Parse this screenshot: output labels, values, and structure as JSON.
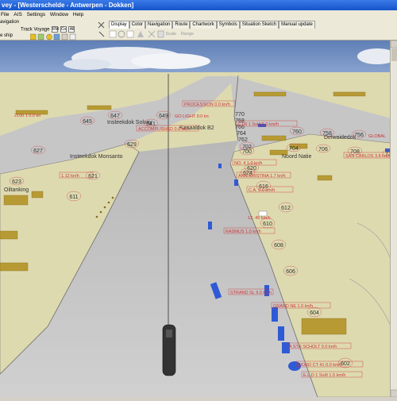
{
  "window": {
    "title": "vey - [Westerschelde - Antwerpen - Dokken]"
  },
  "menu": [
    "File",
    "AIS",
    "Settings",
    "Window",
    "Help"
  ],
  "toolbar": {
    "left_row1": "avigation",
    "left_row2": "Track  Voyage",
    "left_row3": "e ship",
    "mini_buttons": [
      "RM",
      "Co",
      "All"
    ],
    "tabs": [
      "Display",
      "Color",
      "Navigation",
      "Route",
      "Chartwork",
      "Symbols",
      "Situation Sketch",
      "Manual update"
    ],
    "active_tab": "Display",
    "tools": [
      "Scale",
      "Range"
    ]
  },
  "chart": {
    "places": [
      "Insteekdok Solvay",
      "Kanaaldok B2",
      "Insteekdok Monsanto",
      "Oiltanking",
      "Delwaidedok",
      "Noord Natie"
    ],
    "buoys": [
      "645",
      "647",
      "641",
      "649",
      "627",
      "629",
      "623",
      "621",
      "611",
      "760",
      "758",
      "756",
      "770",
      "768",
      "766",
      "764",
      "762",
      "702",
      "700",
      "704",
      "706",
      "708",
      "718",
      "616",
      "620",
      "624",
      "612",
      "610",
      "608",
      "606",
      "604",
      "602"
    ],
    "vessel_labels": [
      "ACCOMPLISHED 0.0 kn/h",
      "PROCESSION 0.0 kn/h",
      "2100 1 0.0 kn",
      "GO LIGHT 0.0 kn",
      "SAN CARLOS 3.8 kn/h",
      "1.12 kn/h",
      "GLOBAL",
      "CTR 1 Sol/t 5.0 km/h",
      "ANN-KRISTINA 1.7 kn/h",
      "C.A. 0.0 km/h",
      "NO. 4 1.0 kn/h",
      "RASMUS 1.0 kn/h",
      "12. 45 km/h",
      "STRAND SL 9.0 kn/h",
      "GRAND NE 1.0 kn/h",
      "A STR SCHOLT 0.0 kn/h",
      "FIORD CT 41 0.0 km/h",
      "E.L.D 1 Sol/t 1.5 km/h"
    ],
    "colors": {
      "land": "#dedab0",
      "water": "#c6c6c6",
      "sky": "#5f7fb6",
      "building": "#b89a34",
      "ship": "#2e5ad6",
      "label": "#cc3333"
    }
  }
}
